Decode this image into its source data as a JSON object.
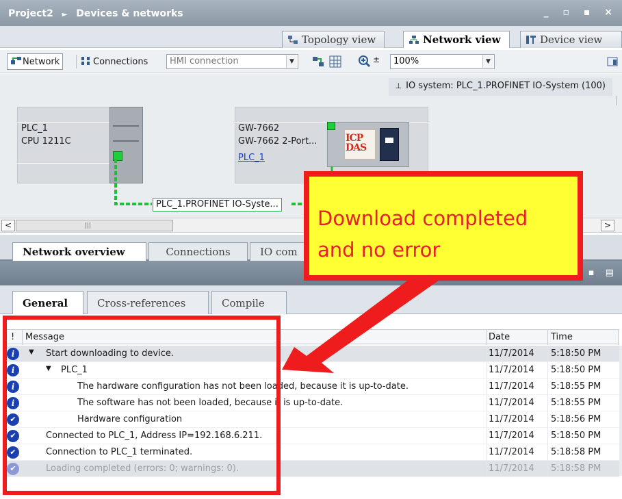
{
  "window": {
    "title": "Project2",
    "breadcrumb_sep": "►",
    "section": "Devices & networks",
    "controls": "_ ▫ ▪ ×"
  },
  "view_tabs": [
    {
      "label": "Topology view"
    },
    {
      "label": "Network view"
    },
    {
      "label": "Device view"
    }
  ],
  "toolbar": {
    "network_label": "Network",
    "connections_label": "Connections",
    "connection_type": "HMI connection",
    "zoom": "100%"
  },
  "canvas": {
    "io_system": "IO system: PLC_1.PROFINET IO-System (100)",
    "plc": {
      "name": "PLC_1",
      "cpu": "CPU 1211C"
    },
    "gateway": {
      "name": "GW-7662",
      "model": "GW-7662 2-Port...",
      "assigned": "PLC_1",
      "logo": "ICP DAS"
    },
    "profinet_label": "PLC_1.PROFINET IO-Syste..."
  },
  "overview_tabs": [
    {
      "label": "Network overview"
    },
    {
      "label": "Connections"
    },
    {
      "label": "IO com"
    }
  ],
  "inspector_tabs": [
    {
      "label": "General"
    },
    {
      "label": "Cross-references"
    },
    {
      "label": "Compile"
    }
  ],
  "messages": {
    "headers": {
      "flag": "!",
      "message": "Message",
      "date": "Date",
      "time": "Time"
    },
    "rows": [
      {
        "icon": "info",
        "text": "Start downloading to device.",
        "date": "11/7/2014",
        "time": "5:18:50 PM"
      },
      {
        "icon": "info",
        "text": "PLC_1",
        "date": "11/7/2014",
        "time": "5:18:50 PM"
      },
      {
        "icon": "info",
        "text": "The hardware configuration has not been loaded, because it is up-to-date.",
        "date": "11/7/2014",
        "time": "5:18:55 PM"
      },
      {
        "icon": "info",
        "text": "The software has not been loaded, because it is up-to-date.",
        "date": "11/7/2014",
        "time": "5:18:55 PM"
      },
      {
        "icon": "ok",
        "text": "Hardware configuration",
        "date": "11/7/2014",
        "time": "5:18:56 PM"
      },
      {
        "icon": "ok",
        "text": "Connected to PLC_1, Address IP=192.168.6.211.",
        "date": "11/7/2014",
        "time": "5:18:50 PM"
      },
      {
        "icon": "ok",
        "text": "Connection to PLC_1 terminated.",
        "date": "11/7/2014",
        "time": "5:18:58 PM"
      },
      {
        "icon": "ok",
        "text": "Loading completed (errors: 0; warnings: 0).",
        "date": "11/7/2014",
        "time": "5:18:58 PM"
      }
    ]
  },
  "annotation": {
    "line1": "Download completed",
    "line2": "and no error",
    "color_fill": "#ffff33",
    "color_border": "#ee1c1c"
  },
  "icons": {
    "info": "info-icon",
    "ok": "check-icon"
  }
}
